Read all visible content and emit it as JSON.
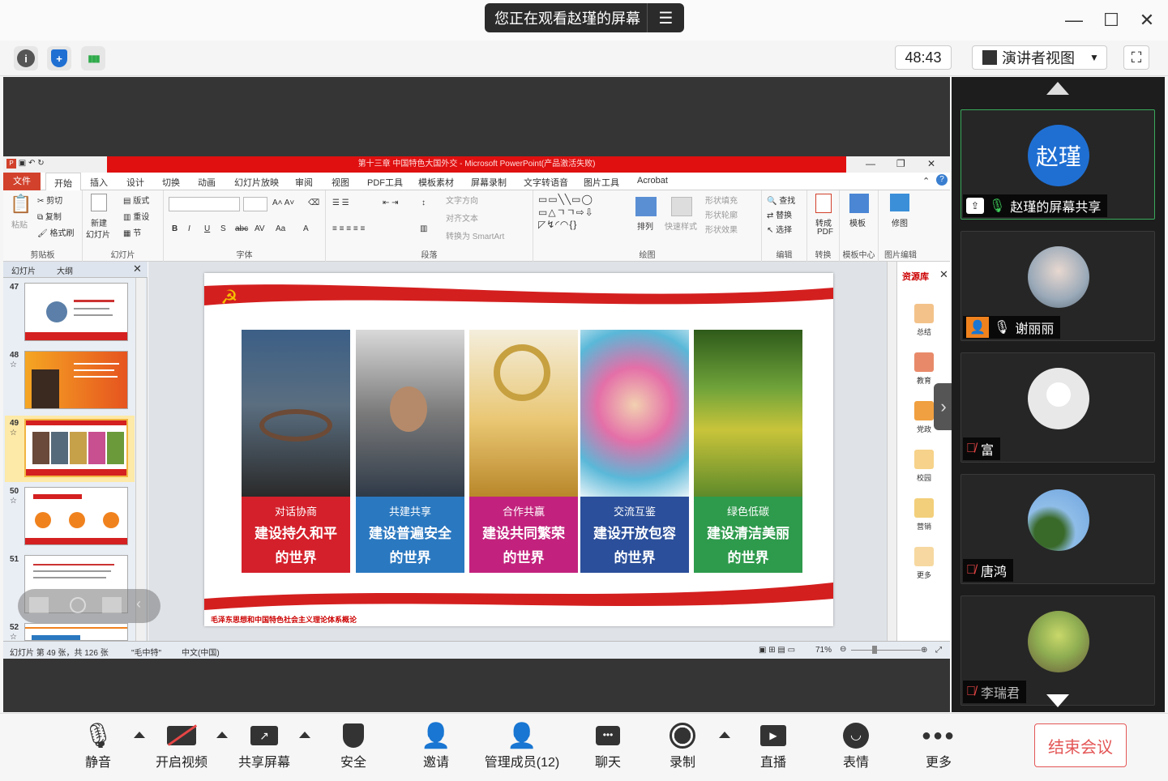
{
  "window": {
    "share_banner": "您正在观看赵瑾的屏幕",
    "menu_glyph": "☰",
    "minimize": "—",
    "maximize": "☐",
    "close": "✕"
  },
  "infobar": {
    "timer": "48:43",
    "view_mode": "演讲者视图",
    "view_caret": "▼",
    "info_glyph": "i",
    "shield_glyph": "+",
    "signal_glyph": "▮▮▮",
    "fullscreen_glyph": "⛶"
  },
  "ppt": {
    "title": "第十三章 中国特色大国外交 - Microsoft PowerPoint(产品激活失败)",
    "tabs": [
      "文件",
      "开始",
      "插入",
      "设计",
      "切换",
      "动画",
      "幻灯片放映",
      "审阅",
      "视图",
      "PDF工具",
      "模板素材",
      "屏幕录制",
      "文字转语音",
      "图片工具",
      "Acrobat"
    ],
    "ribbon": {
      "clipboard": {
        "label": "剪贴板",
        "paste": "粘贴",
        "cut": "剪切",
        "copy": "复制",
        "format_painter": "格式刷"
      },
      "slides": {
        "label": "幻灯片",
        "new": "新建",
        "new2": "幻灯片",
        "layout": "版式",
        "reset": "重设",
        "section": "节"
      },
      "font": {
        "label": "字体"
      },
      "paragraph": {
        "label": "段落",
        "text_direction": "文字方向",
        "align_text": "对齐文本",
        "smartart": "转换为 SmartArt"
      },
      "drawing": {
        "label": "绘图",
        "arrange": "排列",
        "quick_styles": "快速样式",
        "shape_fill": "形状填充",
        "shape_outline": "形状轮廓",
        "shape_effects": "形状效果"
      },
      "editing": {
        "label": "编辑",
        "find": "查找",
        "replace": "替换",
        "select": "选择"
      },
      "convert": {
        "label": "转换",
        "to_pdf": "转成",
        "pdf": "PDF"
      },
      "template_center": {
        "label": "模板中心",
        "template": "模板"
      },
      "image_edit": {
        "label": "图片编辑",
        "retouch": "修图"
      }
    },
    "left_tabs": [
      "幻灯片",
      "大纲"
    ],
    "thumbnails": [
      {
        "num": "47",
        "mark": ""
      },
      {
        "num": "48",
        "mark": "☆"
      },
      {
        "num": "49",
        "mark": "☆"
      },
      {
        "num": "50",
        "mark": "☆"
      },
      {
        "num": "51",
        "mark": ""
      },
      {
        "num": "52",
        "mark": "☆"
      }
    ],
    "slide": {
      "cards": [
        {
          "kicker": "对话协商",
          "line1": "建设持久和平",
          "line2": "的世界",
          "color": "#d4202b"
        },
        {
          "kicker": "共建共享",
          "line1": "建设普遍安全",
          "line2": "的世界",
          "color": "#2a78c0"
        },
        {
          "kicker": "合作共赢",
          "line1": "建设共同繁荣",
          "line2": "的世界",
          "color": "#c2227d"
        },
        {
          "kicker": "交流互鉴",
          "line1": "建设开放包容",
          "line2": "的世界",
          "color": "#2b4f9a"
        },
        {
          "kicker": "绿色低碳",
          "line1": "建设清洁美丽",
          "line2": "的世界",
          "color": "#2e9a4c"
        }
      ],
      "footer": "毛泽东思想和中国特色社会主义理论体系概论"
    },
    "resource_panel": {
      "title": "资源库",
      "close": "✕",
      "items": [
        "总结",
        "教育",
        "党政",
        "校园",
        "营销",
        "更多"
      ]
    },
    "status": {
      "slide_info": "幻灯片 第 49 张，共 126 张",
      "theme": "\"毛中特\"",
      "language": "中文(中国)",
      "zoom": "71%"
    }
  },
  "participants": [
    {
      "name": "赵瑾的屏幕共享",
      "avatar_text": "赵瑾",
      "mic": "on",
      "speaking": true,
      "avatar_color": "#1f6fd3"
    },
    {
      "name": "谢丽丽",
      "avatar_text": "",
      "mic": "on",
      "speaking": false,
      "avatar_color": "#9aa9b8"
    },
    {
      "name": "富",
      "avatar_text": "",
      "mic": "off",
      "speaking": false,
      "avatar_color": "#e8e8e8"
    },
    {
      "name": "唐鸿",
      "avatar_text": "",
      "mic": "off",
      "speaking": false,
      "avatar_color": "#6ea3e0"
    },
    {
      "name": "李瑞君",
      "avatar_text": "",
      "mic": "off",
      "speaking": false,
      "avatar_color": "#8fae52"
    }
  ],
  "toolbar": {
    "mute": "静音",
    "video": "开启视频",
    "share": "共享屏幕",
    "security": "安全",
    "invite": "邀请",
    "members": "管理成员(12)",
    "chat": "聊天",
    "record": "录制",
    "live": "直播",
    "reactions": "表情",
    "more": "更多",
    "end": "结束会议"
  }
}
